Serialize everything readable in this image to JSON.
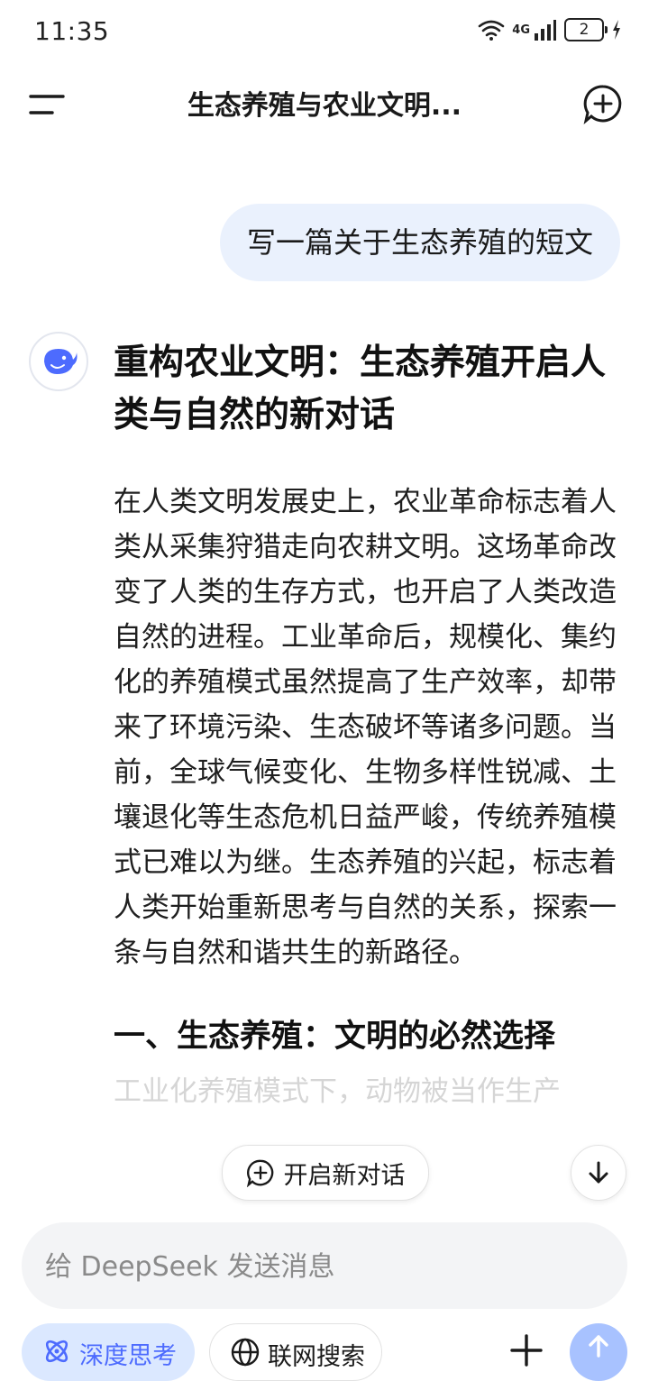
{
  "status_bar": {
    "time": "11:35",
    "network": "4G",
    "battery": "2"
  },
  "header": {
    "title": "生态养殖与农业文明..."
  },
  "conversation": {
    "user_message": "写一篇关于生态养殖的短文",
    "answer": {
      "title": "重构农业文明：生态养殖开启人类与自然的新对话",
      "paragraph": "在人类文明发展史上，农业革命标志着人类从采集狩猎走向农耕文明。这场革命改变了人类的生存方式，也开启了人类改造自然的进程。工业革命后，规模化、集约化的养殖模式虽然提高了生产效率，却带来了环境污染、生态破坏等诸多问题。当前，全球气候变化、生物多样性锐减、土壤退化等生态危机日益严峻，传统养殖模式已难以为继。生态养殖的兴起，标志着人类开始重新思考与自然的关系，探索一条与自然和谐共生的新路径。",
      "section_heading": "一、生态养殖：文明的必然选择",
      "section_text_partial": "工业化养殖模式下，动物被当作生产"
    }
  },
  "floating": {
    "new_dialog_label": "开启新对话"
  },
  "composer": {
    "placeholder": "给 DeepSeek 发送消息"
  },
  "toolbar": {
    "deep_think_label": "深度思考",
    "web_search_label": "联网搜索"
  },
  "colors": {
    "accent": "#4d6bfe",
    "user_bubble": "#eaf1fd",
    "deep_chip_bg": "#dbe8ff",
    "send_button": "#a8c2ff"
  },
  "icons": {
    "menu": "menu-icon",
    "new_chat": "new-chat-icon",
    "avatar": "deepseek-whale-icon",
    "scroll_down": "arrow-down-icon",
    "deep_think": "atom-icon",
    "web_search": "globe-icon",
    "attach": "plus-icon",
    "send": "arrow-up-icon"
  }
}
